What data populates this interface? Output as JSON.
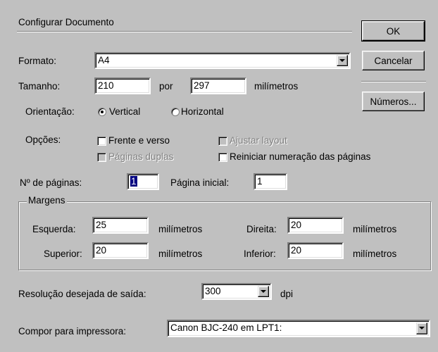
{
  "header": {
    "title": "Configurar Documento"
  },
  "buttons": {
    "ok": "OK",
    "cancel": "Cancelar",
    "numbers": "Números..."
  },
  "format": {
    "label": "Formato:",
    "value": "A4"
  },
  "size": {
    "label": "Tamanho:",
    "width": "210",
    "by": "por",
    "height": "297",
    "unit": "milímetros"
  },
  "orientation": {
    "label": "Orientação:",
    "vertical": "Vertical",
    "horizontal": "Horizontal",
    "selected": "Vertical"
  },
  "options": {
    "label": "Opções:",
    "duplex": "Frente e verso",
    "adjust_layout": "Ajustar layout",
    "double_pages": "Páginas duplas",
    "restart_numbering": "Reiniciar numeração das páginas"
  },
  "pages": {
    "count_label": "Nº de páginas:",
    "count_value": "1",
    "start_label": "Página inicial:",
    "start_value": "1"
  },
  "margins": {
    "legend": "Margens",
    "left_label": "Esquerda:",
    "left_value": "25",
    "right_label": "Direita:",
    "right_value": "20",
    "top_label": "Superior:",
    "top_value": "20",
    "bottom_label": "Inferior:",
    "bottom_value": "20",
    "unit": "milímetros"
  },
  "resolution": {
    "label": "Resolução desejada de saída:",
    "value": "300",
    "unit": "dpi"
  },
  "printer": {
    "label": "Compor para impressora:",
    "value": "Canon  BJC-240 em LPT1:"
  }
}
